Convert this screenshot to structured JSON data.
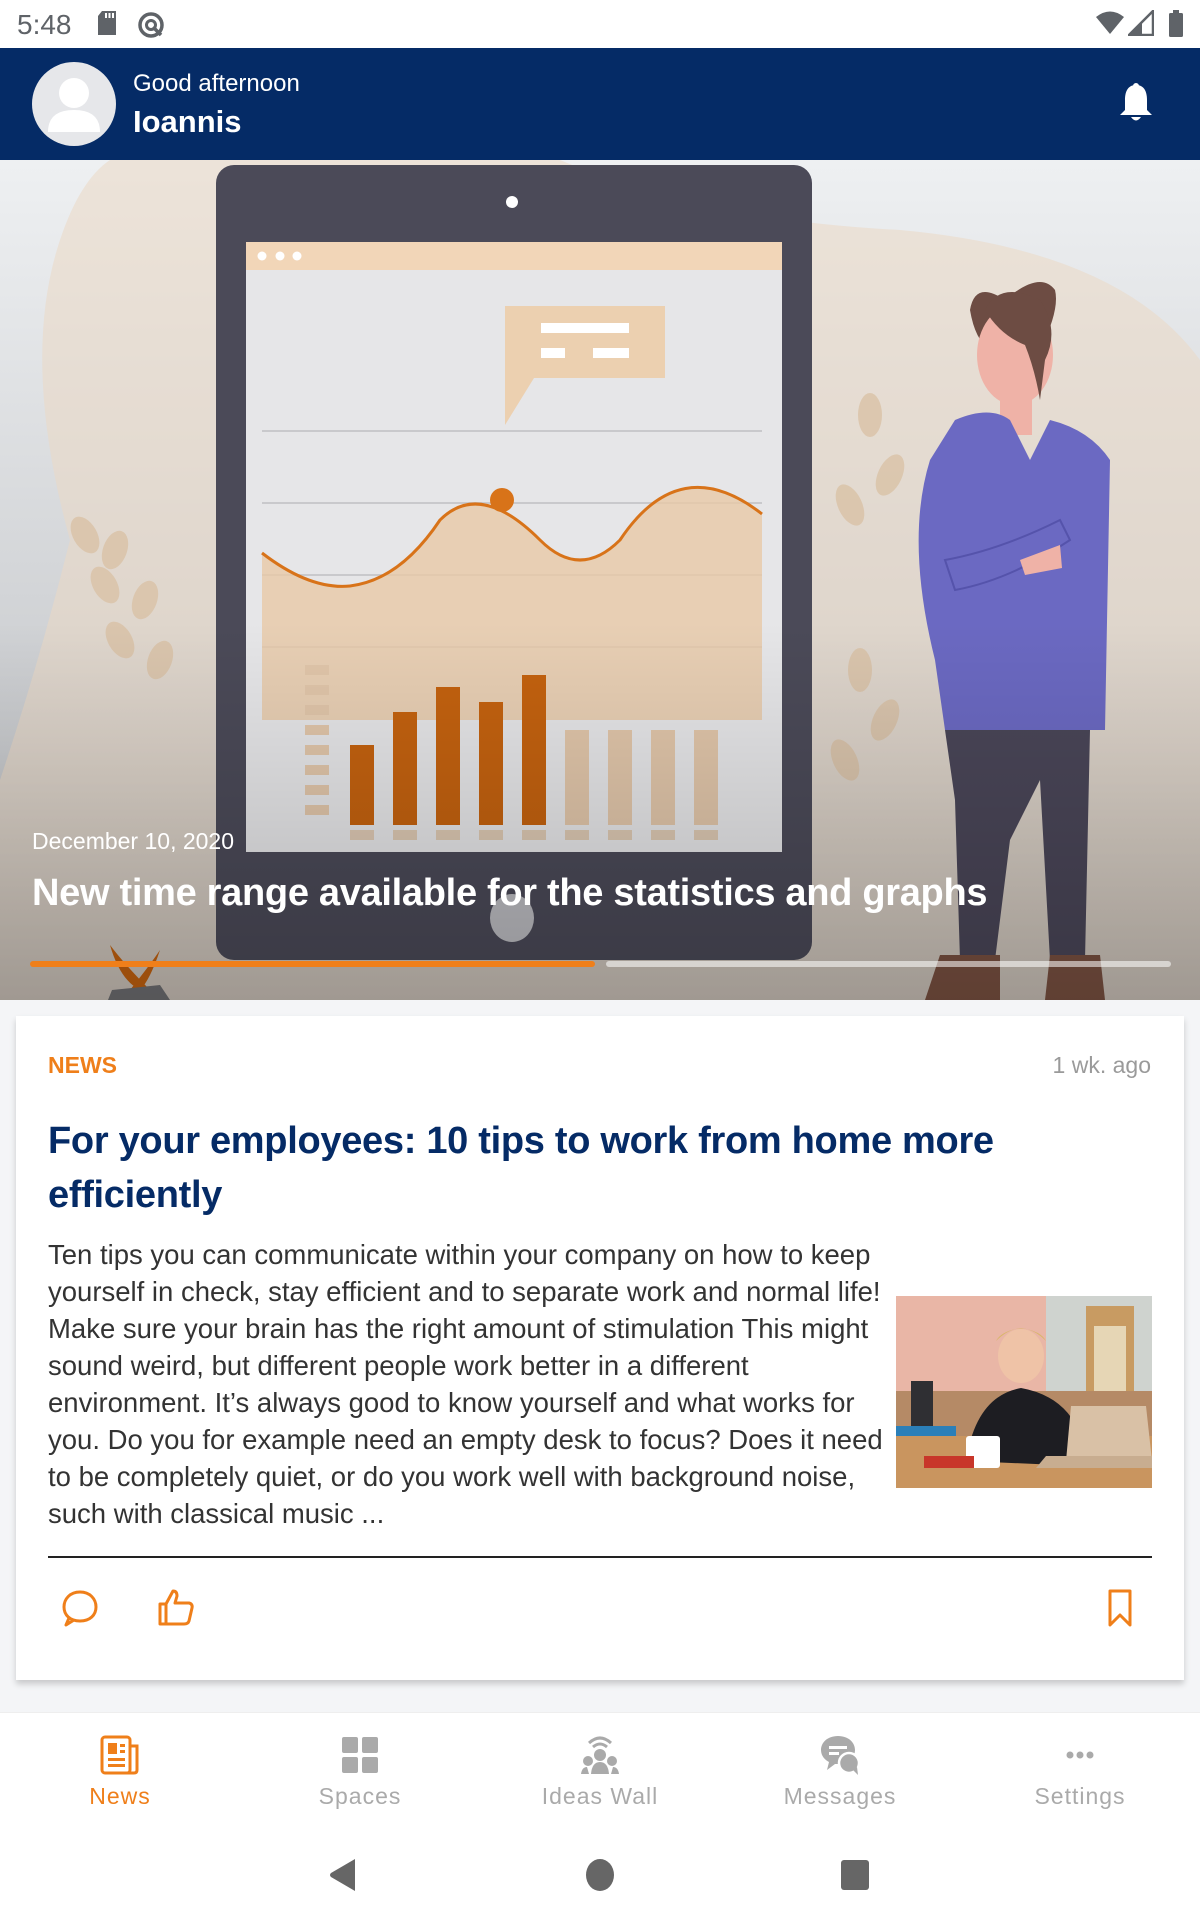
{
  "status_bar": {
    "time": "5:48",
    "icons": [
      "sd-card-icon",
      "data-saver-icon",
      "wifi-icon",
      "signal-icon",
      "battery-icon"
    ]
  },
  "header": {
    "greeting": "Good afternoon",
    "username": "Ioannis",
    "avatar_icon": "user-avatar-icon",
    "notification_icon": "bell-icon"
  },
  "hero": {
    "date": "December 10, 2020",
    "title": "New time range available for the statistics and graphs",
    "slides_total": 2,
    "active_slide": 1
  },
  "card": {
    "category": "NEWS",
    "time_ago": "1 wk. ago",
    "title": "For your employees: 10 tips to work from home more efficiently",
    "body": "Ten tips you can communicate within your company on how to keep yourself in check, stay efficient and to separate work and normal life!    Make sure your brain has the right amount of stimulation This might sound weird, but different people work better in a different environment. It’s always good to know yourself and what works for you. Do you for example need an empty desk to focus? Does it need to be completely quiet, or do you work well with background noise, such with classical music ...",
    "image_alt": "Woman at desk with laptop and coffee mug",
    "actions": {
      "comment_icon": "comment-icon",
      "like_icon": "thumbs-up-icon",
      "bookmark_icon": "bookmark-icon"
    }
  },
  "bottom_nav": {
    "items": [
      {
        "label": "News",
        "icon": "newspaper-icon",
        "active": true
      },
      {
        "label": "Spaces",
        "icon": "grid-icon",
        "active": false
      },
      {
        "label": "Ideas Wall",
        "icon": "ideas-broadcast-icon",
        "active": false
      },
      {
        "label": "Messages",
        "icon": "chat-bubbles-icon",
        "active": false
      },
      {
        "label": "Settings",
        "icon": "more-dots-icon",
        "active": false
      }
    ]
  },
  "colors": {
    "primary": "#052b66",
    "accent": "#ef7f1a",
    "inactive": "#aaaaaa"
  }
}
